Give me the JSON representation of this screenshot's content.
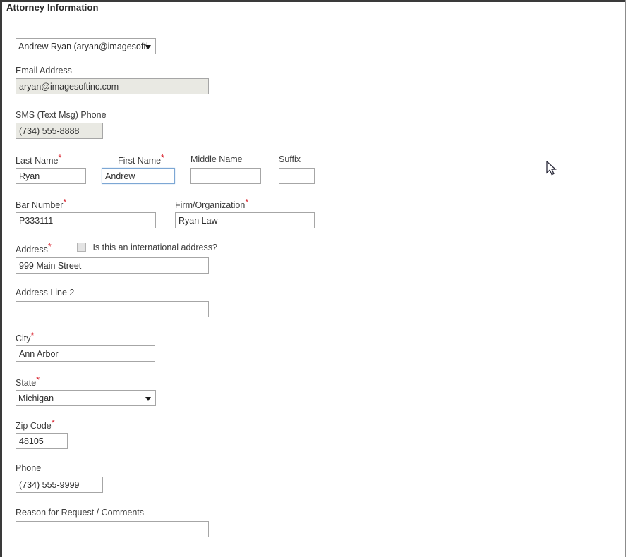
{
  "page": {
    "title": "Attorney Information"
  },
  "attorney_select": {
    "name": "attorney-picker",
    "selected": "Andrew Ryan (aryan@imagesofti",
    "options": [
      "Andrew Ryan (aryan@imagesofti"
    ]
  },
  "fields": {
    "email": {
      "label": "Email Address",
      "value": "aryan@imagesoftinc.com",
      "readonly": true
    },
    "sms_phone": {
      "label": "SMS (Text Msg) Phone",
      "value": "(734) 555-8888",
      "readonly": true
    },
    "last_name": {
      "label": "Last Name",
      "required": true,
      "value": "Ryan"
    },
    "first_name": {
      "label": "First Name",
      "required": true,
      "value": "Andrew",
      "focused": true
    },
    "middle_name": {
      "label": "Middle Name",
      "required": false,
      "value": ""
    },
    "suffix": {
      "label": "Suffix",
      "required": false,
      "value": ""
    },
    "bar_number": {
      "label": "Bar Number",
      "required": true,
      "value": "P333111"
    },
    "firm": {
      "label": "Firm/Organization",
      "required": true,
      "value": "Ryan Law"
    },
    "address": {
      "label": "Address",
      "required": true,
      "value": "999 Main Street"
    },
    "international": {
      "label": "Is this an international address?",
      "checked": false
    },
    "address2": {
      "label": "Address Line 2",
      "required": false,
      "value": ""
    },
    "city": {
      "label": "City",
      "required": true,
      "value": "Ann Arbor"
    },
    "state": {
      "label": "State",
      "required": true,
      "selected": "Michigan",
      "options": [
        "Michigan"
      ]
    },
    "zip": {
      "label": "Zip Code",
      "required": true,
      "value": "48105"
    },
    "phone": {
      "label": "Phone",
      "required": false,
      "value": "(734) 555-9999"
    },
    "reason": {
      "label": "Reason for Request / Comments",
      "required": false,
      "value": ""
    }
  },
  "required_marker": "*",
  "colors": {
    "required": "#d9232e",
    "focus_border": "#7da7d4",
    "readonly_bg": "#e9e9e3",
    "field_border": "#a6a6a6",
    "frame": "#3a3a3a"
  }
}
